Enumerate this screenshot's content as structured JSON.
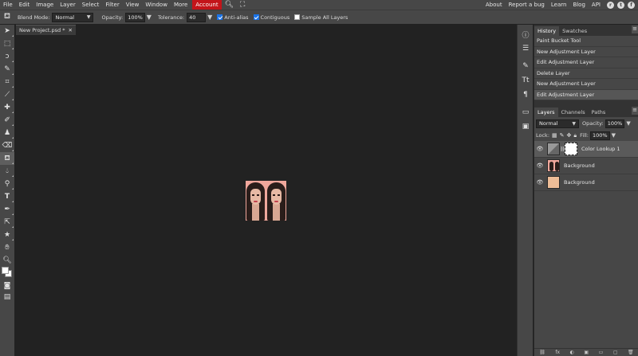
{
  "menubar": {
    "items": [
      "File",
      "Edit",
      "Image",
      "Layer",
      "Select",
      "Filter",
      "View",
      "Window",
      "More"
    ],
    "account": "Account",
    "right_links": [
      "About",
      "Report a bug",
      "Learn",
      "Blog",
      "API"
    ]
  },
  "options": {
    "blend_mode_label": "Blend Mode:",
    "blend_mode_value": "Normal",
    "opacity_label": "Opacity:",
    "opacity_value": "100%",
    "tolerance_label": "Tolerance:",
    "tolerance_value": "40",
    "anti_alias_label": "Anti-alias",
    "contiguous_label": "Contiguous",
    "sample_all_label": "Sample All Layers",
    "anti_alias_checked": true,
    "contiguous_checked": true,
    "sample_all_checked": false
  },
  "document": {
    "tab_title": "New Project.psd *",
    "close_glyph": "✕"
  },
  "history": {
    "tabs": [
      "History",
      "Swatches"
    ],
    "items": [
      "Paint Bucket Tool",
      "New Adjustment Layer",
      "Edit Adjustment Layer",
      "Delete Layer",
      "New Adjustment Layer",
      "Edit Adjustment Layer"
    ]
  },
  "layers_panel": {
    "tabs": [
      "Layers",
      "Channels",
      "Paths"
    ],
    "blend_value": "Normal",
    "opacity_label": "Opacity:",
    "opacity_value": "100%",
    "lock_label": "Lock:",
    "fill_label": "Fill:",
    "fill_value": "100%",
    "layers": [
      {
        "name": "Color Lookup 1"
      },
      {
        "name": "Background"
      },
      {
        "name": "Background"
      }
    ]
  },
  "colors": {
    "account_bg": "#c3141a",
    "image_bg": "#f0a79c",
    "solid_layer": "#eebd97"
  }
}
